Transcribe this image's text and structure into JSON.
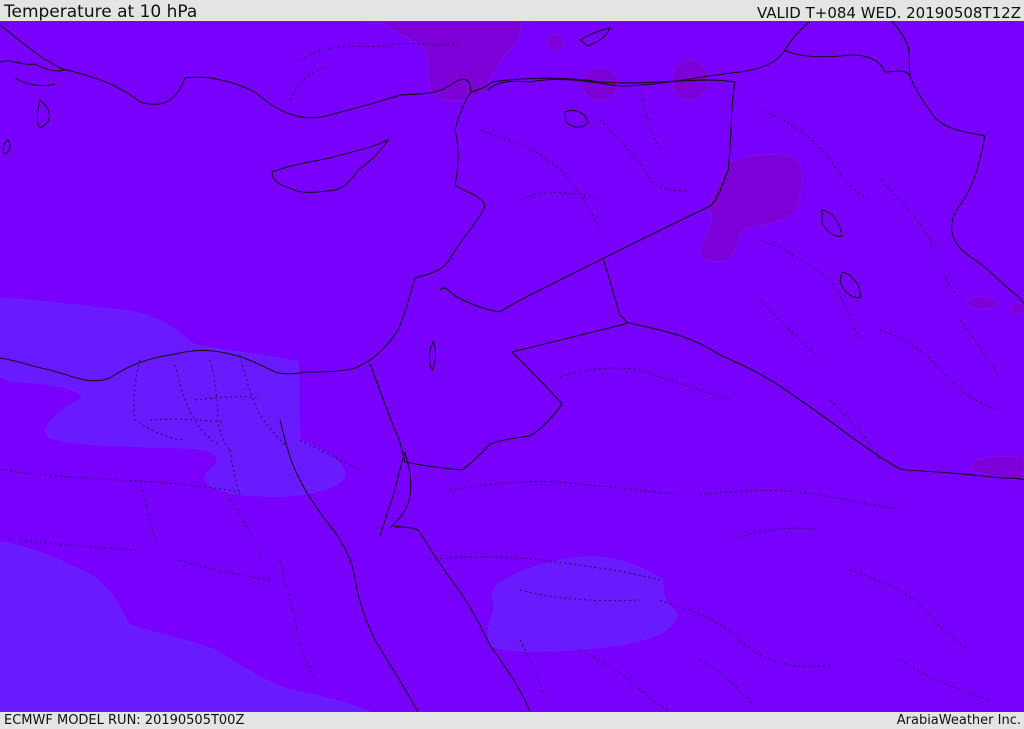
{
  "header": {
    "title": "Temperature at 10 hPa",
    "valid": "VALID T+084 WED. 20190508T12Z"
  },
  "footer": {
    "model_run": "ECMWF MODEL RUN: 20190505T00Z",
    "credit": "ArabiaWeather Inc."
  },
  "colors": {
    "background": "#7900fd",
    "cooler": "#6a1aff",
    "warmer": "#7d00d8",
    "border": "#111111",
    "province": "#2a0a55"
  }
}
